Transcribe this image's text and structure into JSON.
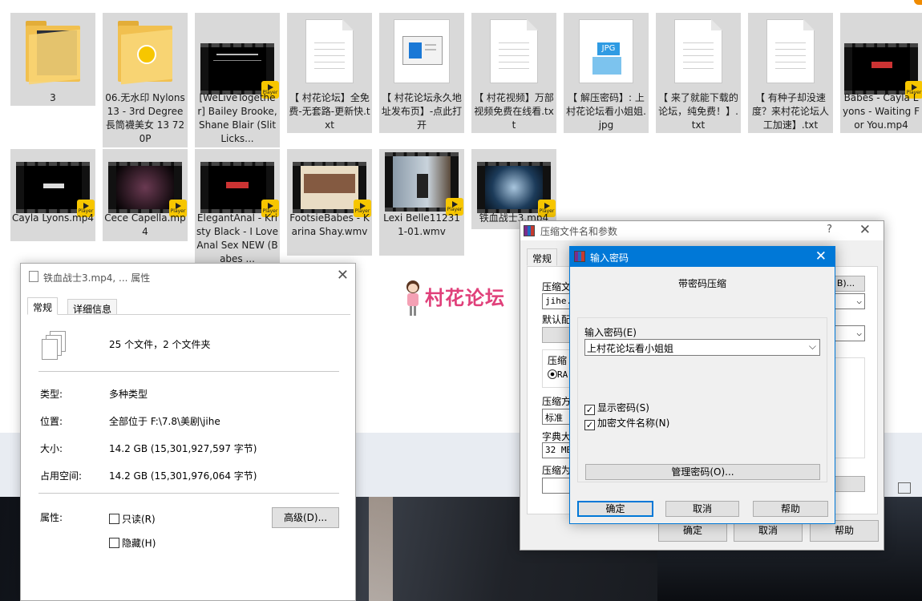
{
  "explorer": {
    "row1": [
      {
        "label": "3",
        "kind": "folder-video"
      },
      {
        "label": "06.无水印 Nylons 13 - 3rd Degree 長筒襪美女 13 720P",
        "kind": "folder-player"
      },
      {
        "label": "[WeLiveTogether] Bailey Brooke, Shane Blair (Slit Licks...",
        "kind": "video"
      },
      {
        "label": "【 村花论坛】全免费-无套路-更新快.txt",
        "kind": "text"
      },
      {
        "label": "【 村花论坛永久地址发布页】-点此打开",
        "kind": "link"
      },
      {
        "label": "【 村花视频】万部视频免费在线看.txt",
        "kind": "text"
      },
      {
        "label": "【 解压密码】: 上村花论坛看小姐姐.jpg",
        "kind": "jpg"
      },
      {
        "label": "【 来了就能下载的论坛，纯免费！】.txt",
        "kind": "text"
      },
      {
        "label": "【 有种子却没速度？来村花论坛人工加速】.txt",
        "kind": "text"
      },
      {
        "label": "Babes - Cayla Lyons - Waiting For You.mp4",
        "kind": "video"
      }
    ],
    "row2": [
      {
        "label": "Cayla Lyons.mp4",
        "kind": "video"
      },
      {
        "label": "Cece Capella.mp4",
        "kind": "video"
      },
      {
        "label": "ElegantAnal - Kristy Black - I Love Anal Sex NEW (Babes ...",
        "kind": "video"
      },
      {
        "label": "FootsieBabes - Karina Shay.wmv",
        "kind": "video"
      },
      {
        "label": "Lexi Belle112311-01.wmv",
        "kind": "video"
      },
      {
        "label": "铁血战士3.mp4",
        "kind": "video"
      }
    ],
    "jpg_badge": "JPG",
    "player_badge": "Player"
  },
  "watermark": {
    "text": "村花论坛"
  },
  "properties": {
    "title": "铁血战士3.mp4, ... 属性",
    "tabs": [
      "常规",
      "详细信息"
    ],
    "summary": "25 个文件，2 个文件夹",
    "rows": [
      {
        "label": "类型:",
        "value": "多种类型"
      },
      {
        "label": "位置:",
        "value": "全部位于 F:\\7.8\\美剧\\jihe"
      },
      {
        "label": "大小:",
        "value": "14.2 GB (15,301,927,597 字节)"
      },
      {
        "label": "占用空间:",
        "value": "14.2 GB (15,301,976,064 字节)"
      }
    ],
    "attr_label": "属性:",
    "readonly": "只读(R)",
    "hidden": "隐藏(H)",
    "advanced": "高级(D)..."
  },
  "archive": {
    "title": "压缩文件名和参数",
    "help": "?",
    "tab": "常规",
    "name_label": "压缩文",
    "name_value": "jihe.r",
    "browse": "B)...",
    "profile_label": "默认配",
    "format_label": "压缩",
    "format_opt": "RA",
    "method_label": "压缩方",
    "method_value": "标准",
    "dict_label": "字典大",
    "dict_value": "32 MB",
    "split_label": "压缩为",
    "ok": "确定",
    "cancel": "取消",
    "helpbtn": "帮助"
  },
  "password": {
    "title": "输入密码",
    "heading": "带密码压缩",
    "input_label": "输入密码(E)",
    "input_value": "上村花论坛看小姐姐",
    "show_pwd": "显示密码(S)",
    "encrypt_names": "加密文件名称(N)",
    "manage": "管理密码(O)...",
    "ok": "确定",
    "cancel": "取消",
    "help": "帮助"
  }
}
